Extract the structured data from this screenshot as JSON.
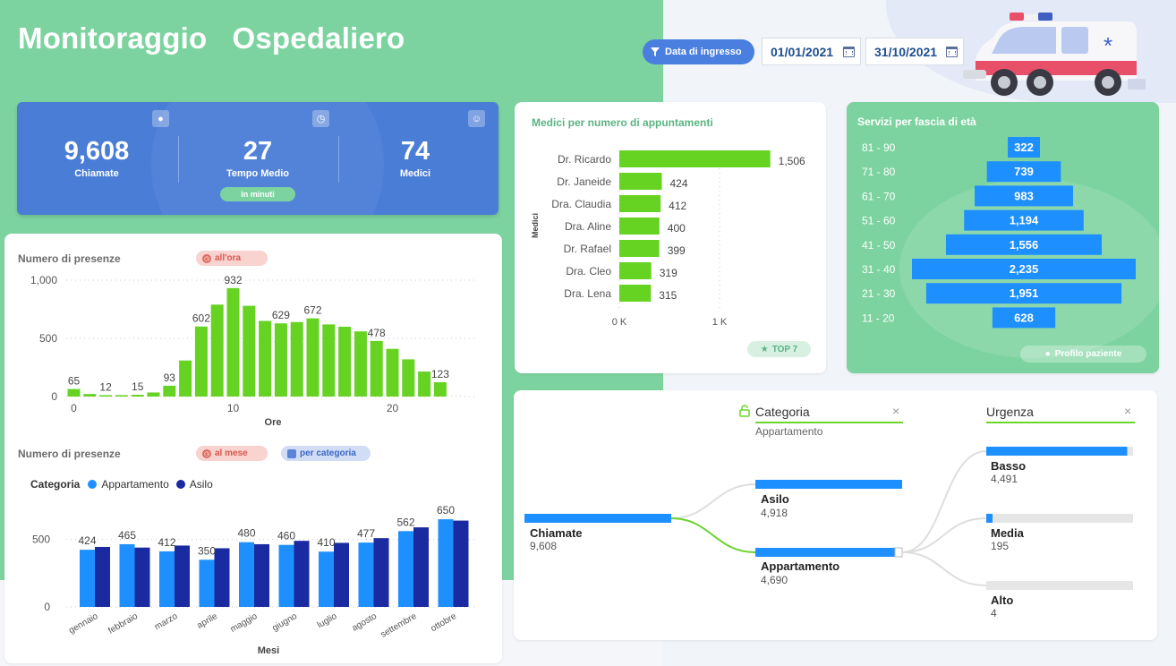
{
  "header": {
    "title": "Monitoraggio   Ospedaliero",
    "filter_label": "Data di ingresso",
    "date_from": "01/01/2021",
    "date_to": "31/10/2021"
  },
  "kpis": [
    {
      "value": "9,608",
      "label": "Chiamate"
    },
    {
      "value": "27",
      "label": "Tempo Medio",
      "badge": "in minuti"
    },
    {
      "value": "74",
      "label": "Medici"
    }
  ],
  "hourly": {
    "title": "Numero di presenze",
    "pill": "all'ora",
    "chart_data": {
      "type": "bar",
      "x": [
        0,
        1,
        2,
        3,
        4,
        5,
        6,
        7,
        8,
        9,
        10,
        11,
        12,
        13,
        14,
        15,
        16,
        17,
        18,
        19,
        20,
        21,
        22,
        23
      ],
      "values": [
        65,
        22,
        12,
        12,
        15,
        35,
        93,
        310,
        602,
        790,
        932,
        780,
        650,
        629,
        640,
        672,
        620,
        600,
        560,
        478,
        410,
        320,
        215,
        123
      ],
      "data_labels": {
        "0": "65",
        "2": "12",
        "4": "15",
        "6": "93",
        "8": "602",
        "10": "932",
        "13": "629",
        "15": "672",
        "19": "478",
        "23": "123"
      },
      "ylim": [
        0,
        1000
      ],
      "yticks": [
        "1,000",
        "500",
        "0"
      ],
      "xticks": [
        "0",
        "10",
        "20"
      ],
      "xlabel": "Ore",
      "color": "#66d323"
    }
  },
  "monthly": {
    "title": "Numero di presenze",
    "pill1": "al mese",
    "pill2": "per categoria",
    "legend_title": "Categoria",
    "chart_data": {
      "type": "bar",
      "categories": [
        "gennaio",
        "febbraio",
        "marzo",
        "aprile",
        "maggio",
        "giugno",
        "luglio",
        "agosto",
        "settembre",
        "ottobre"
      ],
      "series": [
        {
          "name": "Appartamento",
          "color": "#1e8fff",
          "values": [
            424,
            465,
            412,
            350,
            480,
            460,
            410,
            477,
            562,
            650
          ]
        },
        {
          "name": "Asilo",
          "color": "#1a2aa0",
          "values": [
            445,
            440,
            455,
            435,
            465,
            490,
            475,
            510,
            590,
            640
          ]
        }
      ],
      "data_labels": [
        "424",
        "465",
        "412",
        "350",
        "480",
        "460",
        "410",
        "477",
        "562",
        "650"
      ],
      "ylim": [
        0,
        750
      ],
      "yticks": [
        "500",
        "0"
      ],
      "xlabel": "Mesi"
    }
  },
  "medici": {
    "title": "Medici per numero di appuntamenti",
    "badge": "TOP 7",
    "chart_data": {
      "type": "bar",
      "orientation": "horizontal",
      "categories": [
        "Dr. Ricardo",
        "Dr. Janeide",
        "Dra. Claudia",
        "Dra. Aline",
        "Dr. Rafael",
        "Dra. Cleo",
        "Dra. Lena"
      ],
      "values": [
        1506,
        424,
        412,
        400,
        399,
        319,
        315
      ],
      "data_labels": [
        "1,506",
        "424",
        "412",
        "400",
        "399",
        "319",
        "315"
      ],
      "xlim": [
        0,
        1800
      ],
      "xticks": [
        "0 K",
        "1 K"
      ],
      "ylabel": "Medici",
      "color": "#66d323"
    }
  },
  "servizi": {
    "title": "Servizi per fascia di età",
    "badge": "Profilo paziente",
    "chart_data": {
      "type": "bar",
      "orientation": "horizontal-centered",
      "categories": [
        "81 - 90",
        "71 - 80",
        "61 - 70",
        "51 - 60",
        "41 - 50",
        "31 - 40",
        "21 - 30",
        "11 - 20"
      ],
      "values": [
        322,
        739,
        983,
        1194,
        1556,
        2235,
        1951,
        628
      ],
      "data_labels": [
        "322",
        "739",
        "983",
        "1,194",
        "1,556",
        "2,235",
        "1,951",
        "628"
      ],
      "color": "#1e8fff"
    }
  },
  "tree": {
    "col1_title": "Categoria",
    "col1_sub": "Appartamento",
    "col2_title": "Urgenza",
    "close_glyph": "×",
    "root": {
      "label": "Chiamate",
      "value": "9,608"
    },
    "level1": [
      {
        "label": "Asilo",
        "value": "4,918",
        "fraction": 1.0
      },
      {
        "label": "Appartamento",
        "value": "4,690",
        "fraction": 0.95
      }
    ],
    "level2": [
      {
        "label": "Basso",
        "value": "4,491",
        "fraction": 0.96
      },
      {
        "label": "Media",
        "value": "195",
        "fraction": 0.04
      },
      {
        "label": "Alto",
        "value": "4",
        "fraction": 0.0
      }
    ]
  },
  "colors": {
    "green_bg": "#7dd3a0",
    "kpi_blue": "#4a7dd6",
    "bar_green": "#66d323",
    "bar_blue": "#1e8fff",
    "navy": "#1a2aa0"
  }
}
